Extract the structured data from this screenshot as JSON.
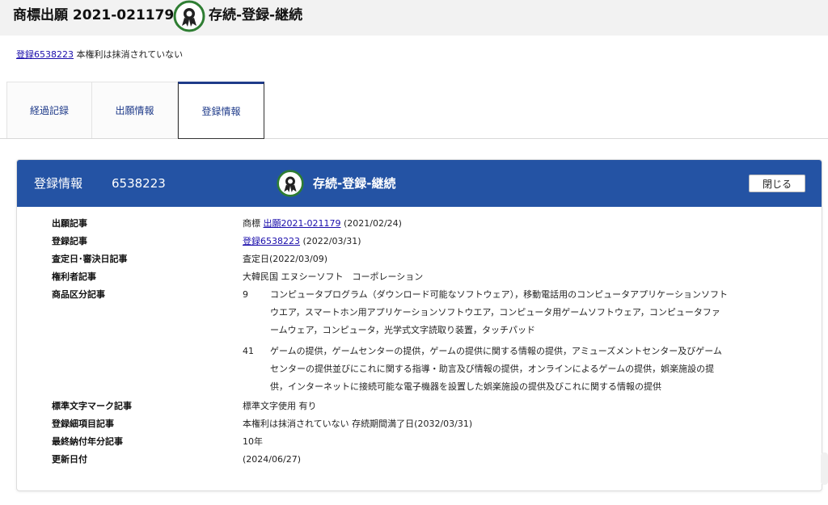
{
  "header": {
    "title": "商標出願 2021-021179",
    "status": "存続-登録-継続",
    "badge_icon": "award-ribbon-icon"
  },
  "registration_line": {
    "link": "登録6538223",
    "text": " 本権利は抹消されていない"
  },
  "tabs": [
    {
      "label": "経過記録",
      "active": false
    },
    {
      "label": "出願情報",
      "active": false
    },
    {
      "label": "登録情報",
      "active": true
    }
  ],
  "panel": {
    "title": "登録情報",
    "number": "6538223",
    "status": "存続-登録-継続",
    "close_label": "閉じる"
  },
  "rows": {
    "application": {
      "label": "出願記事",
      "prefix": "商標 ",
      "link": "出願2021-021179",
      "suffix": " (2021/02/24)"
    },
    "registration": {
      "label": "登録記事",
      "link": "登録6538223",
      "suffix": " (2022/03/31)"
    },
    "examination": {
      "label": "査定日･審決日記事",
      "value": "査定日(2022/03/09)"
    },
    "holder": {
      "label": "権利者記事",
      "value": "大韓民国 エヌシーソフト　コーポレーション"
    },
    "goods": {
      "label": "商品区分記事"
    },
    "standard_char": {
      "label": "標準文字マーク記事",
      "value": "標準文字使用 有り"
    },
    "details": {
      "label": "登録細項目記事",
      "value": "本権利は抹消されていない 存続期間満了日(2032/03/31)"
    },
    "last_payment": {
      "label": "最終納付年分記事",
      "value": "10年"
    },
    "updated": {
      "label": "更新日付",
      "value": "(2024/06/27)"
    }
  },
  "goods_classes": [
    {
      "class": "9",
      "lines": [
        "コンピュータプログラム（ダウンロード可能なソフトウェア），移動電話用のコンピュータアプリケーションソフト",
        "ウエア，スマートホン用アプリケーションソフトウエア，コンピュータ用ゲームソフトウェア，コンピュータファ",
        "ームウェア，コンピュータ，光学式文字読取り装置，タッチパッド"
      ]
    },
    {
      "class": "41",
      "lines": [
        "ゲームの提供，ゲームセンターの提供，ゲームの提供に関する情報の提供，アミューズメントセンター及びゲーム",
        "センターの提供並びにこれに関する指導・助言及び情報の提供，オンラインによるゲームの提供，娯楽施設の提",
        "供，インターネットに接続可能な電子機器を設置した娯楽施設の提供及びこれに関する情報の提供"
      ]
    }
  ],
  "colors": {
    "panel_header": "#2453a4",
    "tab_active_text": "#1f3b8a",
    "link": "#1a0dab",
    "badge_green": "#2e7d32"
  }
}
